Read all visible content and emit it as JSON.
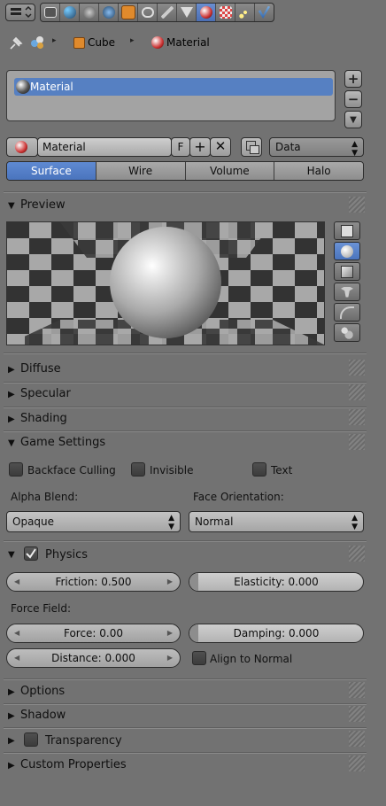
{
  "breadcrumb": {
    "object": "Cube",
    "material": "Material"
  },
  "slots": [
    {
      "name": "Material"
    }
  ],
  "material_field": {
    "name": "Material",
    "fake_user": "F",
    "link_mode": "Data"
  },
  "tabs": [
    "Surface",
    "Wire",
    "Volume",
    "Halo"
  ],
  "panels": {
    "preview": "Preview",
    "diffuse": "Diffuse",
    "specular": "Specular",
    "shading": "Shading",
    "game_settings": "Game Settings",
    "physics": "Physics",
    "options": "Options",
    "shadow": "Shadow",
    "transparency": "Transparency",
    "custom_properties": "Custom Properties"
  },
  "game_settings": {
    "backface_culling": "Backface Culling",
    "invisible": "Invisible",
    "text": "Text",
    "alpha_blend_label": "Alpha Blend:",
    "alpha_blend_value": "Opaque",
    "face_orientation_label": "Face Orientation:",
    "face_orientation_value": "Normal"
  },
  "physics": {
    "friction": "Friction: 0.500",
    "elasticity": "Elasticity: 0.000",
    "force_field_label": "Force Field:",
    "force": "Force: 0.00",
    "damping": "Damping: 0.000",
    "distance": "Distance: 0.000",
    "align_to_normal": "Align to Normal"
  },
  "colors": {
    "accent": "#5680c2",
    "panel_bg": "#727272"
  }
}
